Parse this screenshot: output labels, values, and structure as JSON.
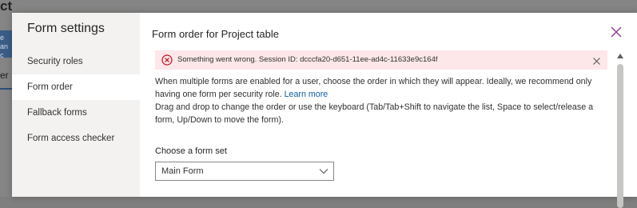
{
  "background": {
    "title_fragment": "ct",
    "blue_tile_text": "e an c",
    "tab_fragment": "er"
  },
  "sidebar": {
    "title": "Form settings",
    "items": [
      {
        "label": "Security roles",
        "active": false
      },
      {
        "label": "Form order",
        "active": true
      },
      {
        "label": "Fallback forms",
        "active": false
      },
      {
        "label": "Form access checker",
        "active": false
      }
    ]
  },
  "main": {
    "title": "Form order for Project table",
    "error": {
      "message": "Something went wrong. Session ID: dcccfa20-d651-11ee-ad4c-11633e9c164f",
      "icon": "error-circle-icon",
      "color": "#c50f1f",
      "background": "#fde7e9"
    },
    "description_1": "When multiple forms are enabled for a user, choose the order in which they will appear. Ideally, we recommend only having one form per security role.",
    "learn_more": "Learn more",
    "description_2": "Drag and drop to change the order or use the keyboard (Tab/Tab+Shift to navigate the list, Space to select/release a form, Up/Down to move the form).",
    "form_set_label": "Choose a form set",
    "form_set_value": "Main Form"
  },
  "colors": {
    "close_icon": "#8e3a8f",
    "link": "#115ea3"
  }
}
